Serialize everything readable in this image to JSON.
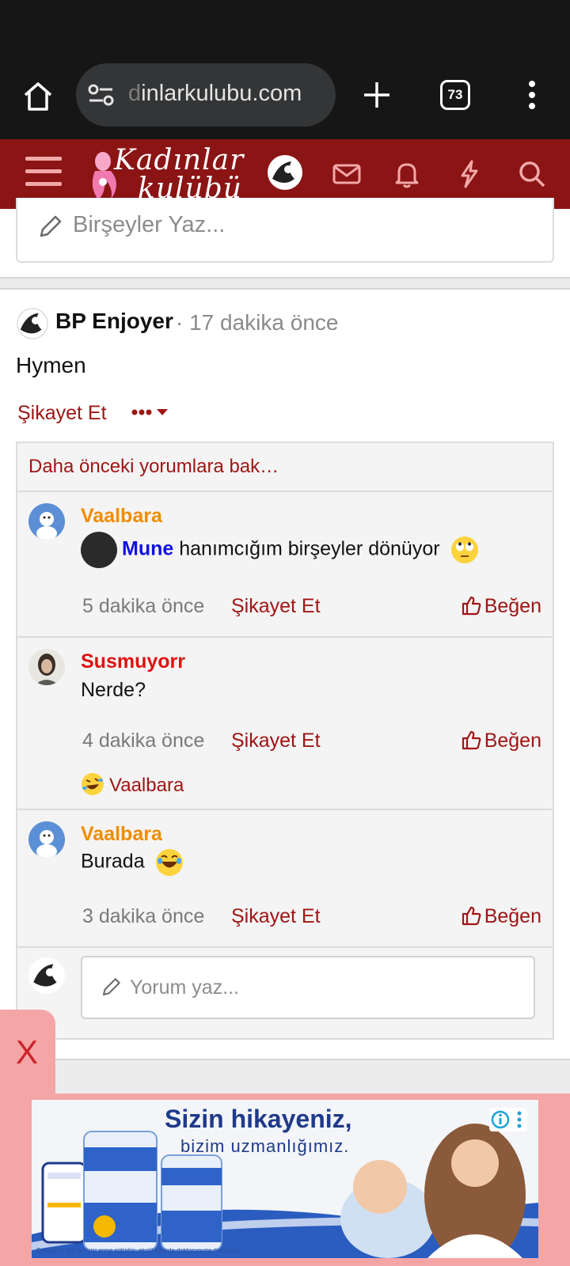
{
  "browser": {
    "url": "dinlarkulubu.com",
    "url_faded_prefix": "d",
    "url_rest": "inlarkulubu.com",
    "tab_count": "73"
  },
  "site": {
    "logo_line1": "Kadınlar",
    "logo_line2": "kulübü",
    "brand_color": "#8b1414"
  },
  "composer": {
    "placeholder": "Birşeyler Yaz..."
  },
  "post": {
    "author": "BP Enjoyer",
    "time": "· 17 dakika önce",
    "body": "Hymen",
    "report_label": "Şikayet Et"
  },
  "comments": {
    "prev_link": "Daha önceki yorumlara bak…",
    "items": [
      {
        "author": "Vaalbara",
        "author_color": "#f08c00",
        "mention": "Mune",
        "text": "hanımcığım birşeyler dönüyor",
        "time": "5 dakika önce",
        "report": "Şikayet Et",
        "like": "Beğen"
      },
      {
        "author": "Susmuyorr",
        "author_color": "#e01010",
        "text": "Nerde?",
        "time": "4 dakika önce",
        "report": "Şikayet Et",
        "like": "Beğen",
        "reaction_by": "Vaalbara"
      },
      {
        "author": "Vaalbara",
        "author_color": "#f08c00",
        "text": "Burada",
        "time": "3 dakika önce",
        "report": "Şikayet Et",
        "like": "Beğen"
      }
    ],
    "reply_placeholder": "Yorum yaz..."
  },
  "ad": {
    "close": "X",
    "headline1": "Sizin hikayeniz,",
    "headline2": "bizim uzmanlığımız.",
    "fine_print": "Bebeğiniz için en iyisi anne sütüdür, ekolikliğimde doktorunuza danışınız."
  }
}
